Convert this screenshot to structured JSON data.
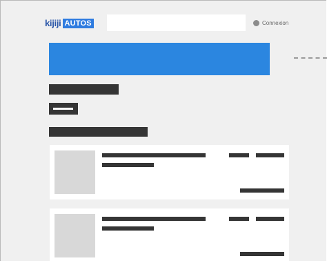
{
  "header": {
    "brand": {
      "part1": "kijiji",
      "part2": "AUTOS",
      "accent": "#2f7ce0",
      "text_color": "#2a56a8"
    },
    "search": {
      "value": "",
      "placeholder": ""
    },
    "login": {
      "label": "Connexion",
      "icon": "user-circle-icon"
    }
  },
  "main": {
    "banner_color": "#2b86e0",
    "listings": [
      {
        "image": "photo-placeholder"
      },
      {
        "image": "photo-placeholder"
      }
    ]
  }
}
